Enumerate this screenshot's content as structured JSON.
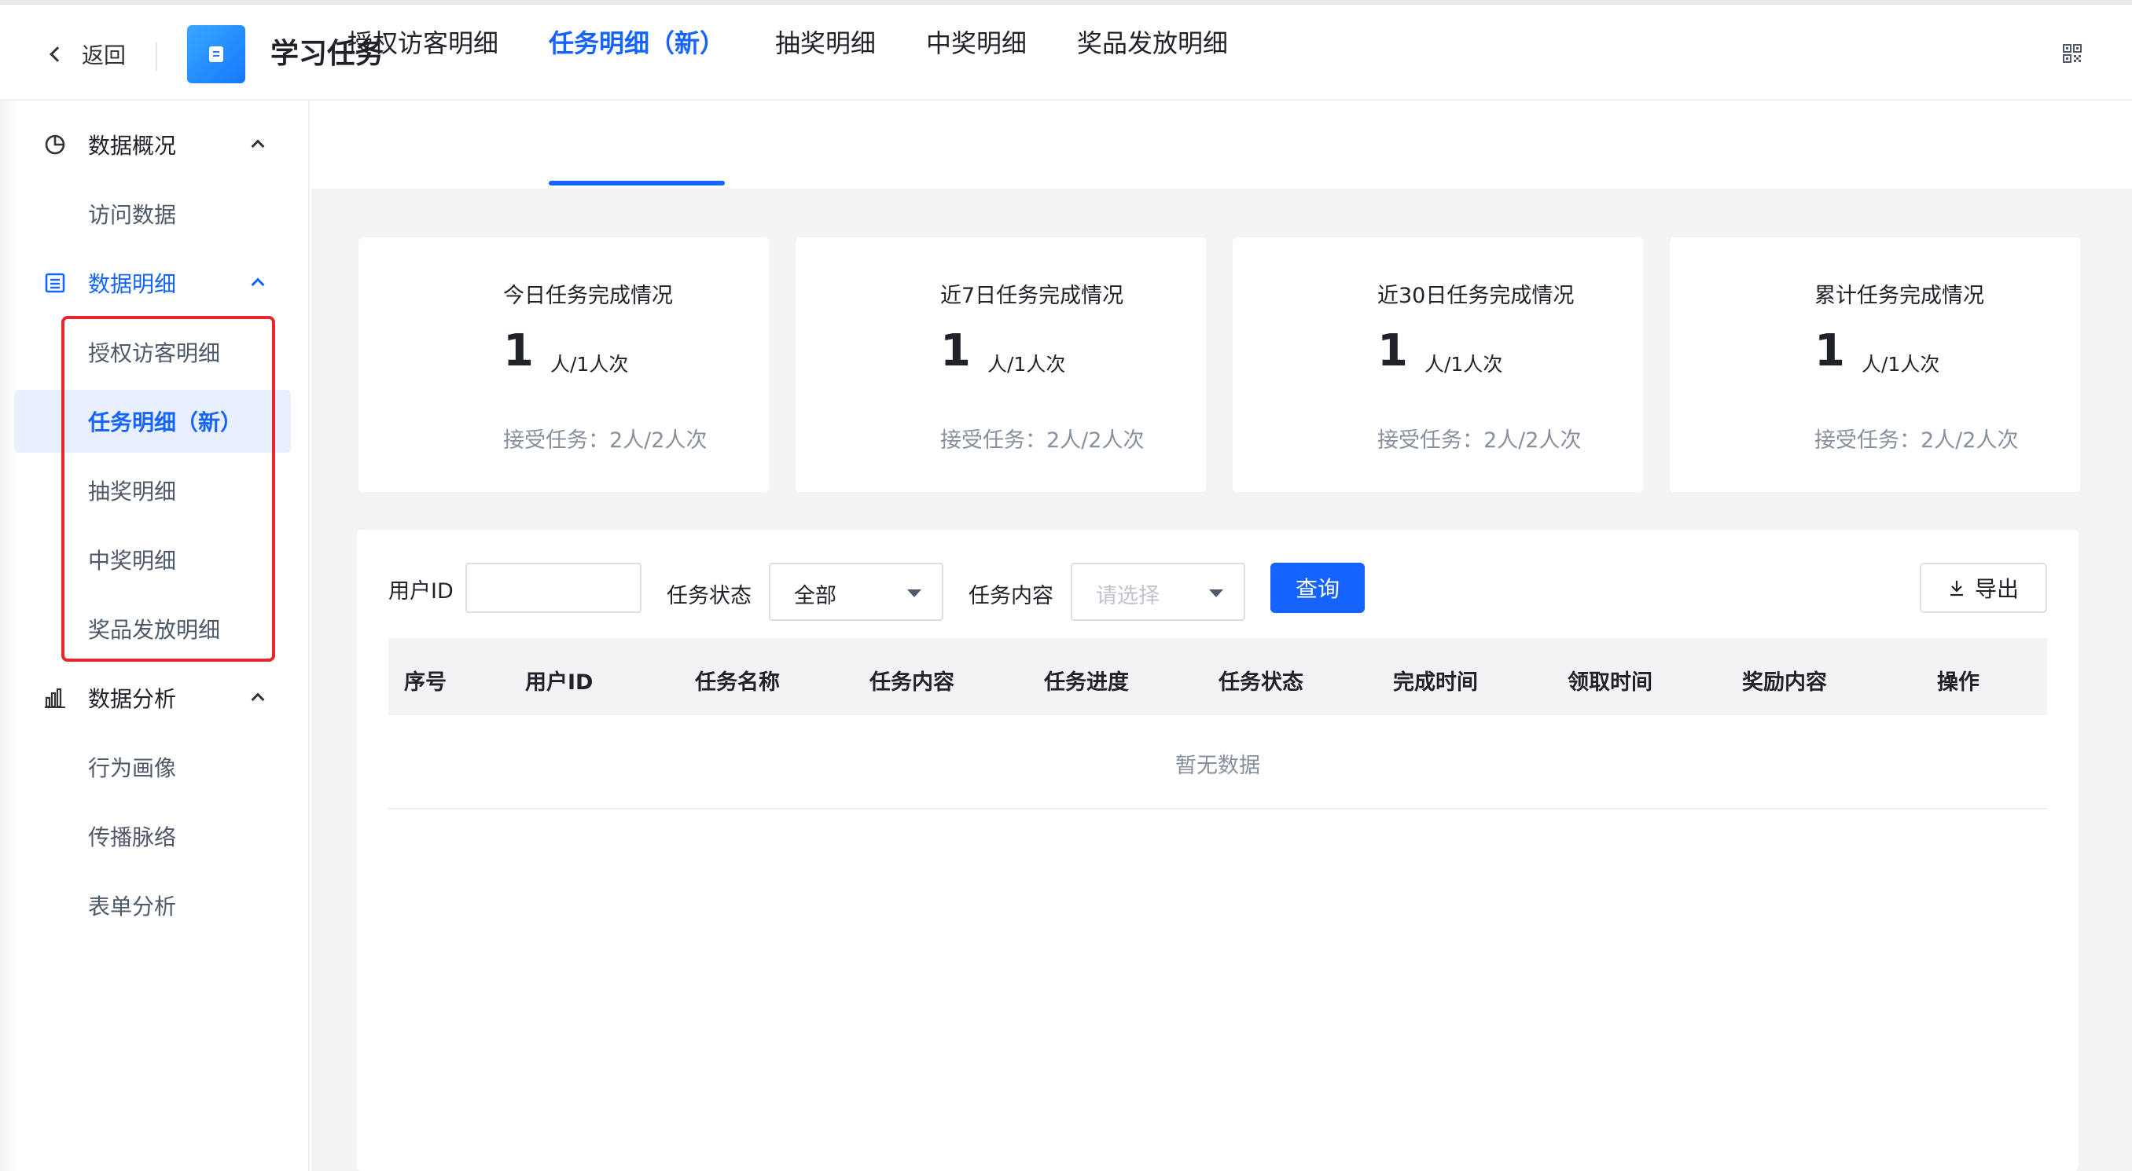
{
  "header": {
    "back_label": "返回",
    "title": "学习任务",
    "right_icon": "qrcode-icon"
  },
  "sidebar": {
    "groups": [
      {
        "label": "数据概况",
        "icon": "pie-chart-icon",
        "items": [
          "访问数据"
        ]
      },
      {
        "label": "数据明细",
        "icon": "list-icon",
        "items": [
          "授权访客明细",
          "任务明细（新）",
          "抽奖明细",
          "中奖明细",
          "奖品发放明细"
        ]
      },
      {
        "label": "数据分析",
        "icon": "bar-chart-icon",
        "items": [
          "行为画像",
          "传播脉络",
          "表单分析"
        ]
      }
    ],
    "active_item": "任务明细（新）"
  },
  "tabs": [
    "授权访客明细",
    "任务明细（新）",
    "抽奖明细",
    "中奖明细",
    "奖品发放明细"
  ],
  "active_tab": "任务明细（新）",
  "cards": [
    {
      "title": "今日任务完成情况",
      "value": "1",
      "unit": "人/1人次",
      "sub": "接受任务：2人/2人次"
    },
    {
      "title": "近7日任务完成情况",
      "value": "1",
      "unit": "人/1人次",
      "sub": "接受任务：2人/2人次"
    },
    {
      "title": "近30日任务完成情况",
      "value": "1",
      "unit": "人/1人次",
      "sub": "接受任务：2人/2人次"
    },
    {
      "title": "累计任务完成情况",
      "value": "1",
      "unit": "人/1人次",
      "sub": "接受任务：2人/2人次"
    }
  ],
  "filters": {
    "user_id_label": "用户ID",
    "user_id_value": "",
    "status_label": "任务状态",
    "status_value": "全部",
    "content_label": "任务内容",
    "content_placeholder": "请选择",
    "query_label": "查询",
    "export_label": "导出"
  },
  "table": {
    "columns": [
      "序号",
      "用户ID",
      "任务名称",
      "任务内容",
      "任务进度",
      "任务状态",
      "完成时间",
      "领取时间",
      "奖励内容",
      "操作"
    ],
    "rows": [],
    "empty_text": "暂无数据"
  },
  "colors": {
    "accent": "#1664ff",
    "highlight_box": "#e8262b",
    "content_bg": "#f2f3f5"
  }
}
